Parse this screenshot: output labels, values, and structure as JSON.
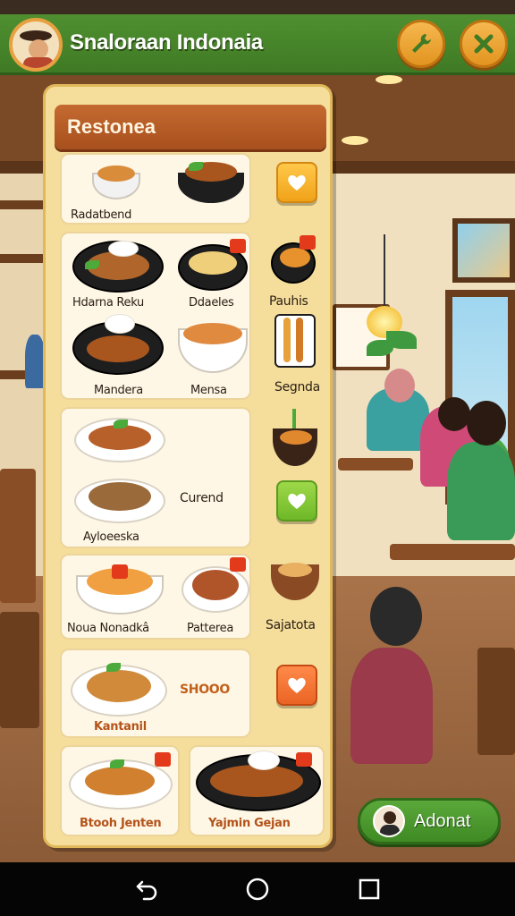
{
  "app": {
    "title": "Snaloraan Indonaia",
    "settings_icon": "wrench-icon",
    "close_icon": "close-icon"
  },
  "menu": {
    "title": "Restonea",
    "sections": [
      {
        "dishes": [
          "Radatbend"
        ],
        "button": {
          "icon": "heart-icon",
          "color": "#f0a218"
        }
      },
      {
        "dishes": [
          "Hdarna Reku",
          "Ddaeles",
          "Mandera",
          "Mensa"
        ],
        "side_labels": [
          "Pauhis",
          "Segnda"
        ]
      },
      {
        "dishes": [
          "Ayloeeska"
        ],
        "text": "Curend",
        "button": {
          "icon": "heart-icon",
          "color": "#6eb828"
        }
      },
      {
        "dishes": [
          "Noua Nonadkâ",
          "Patterea"
        ],
        "side_labels": [
          "Sajatota"
        ]
      },
      {
        "dishes": [
          "Kantanil"
        ],
        "text": "SHOOO",
        "button": {
          "icon": "heart-icon",
          "color": "#ea6424"
        }
      },
      {
        "dishes": [
          "Btooh Jenten",
          "Yajmin Gejan"
        ]
      }
    ]
  },
  "action": {
    "label": "Adonat"
  },
  "navbar": {
    "back_icon": "back-icon",
    "home_icon": "home-icon",
    "recents_icon": "recents-icon"
  }
}
